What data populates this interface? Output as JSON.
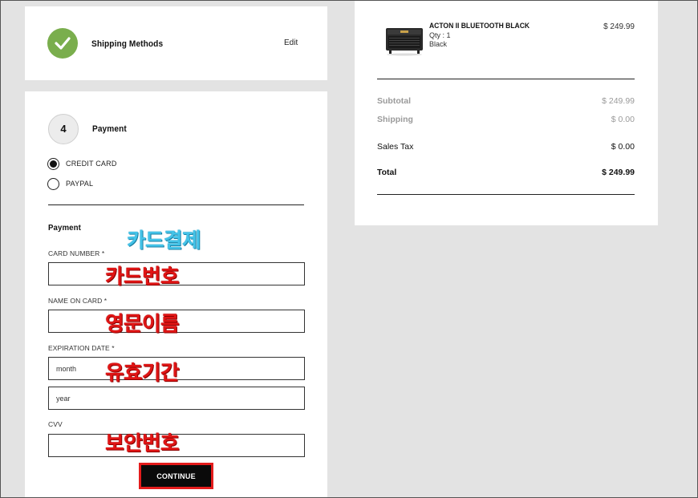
{
  "shipping": {
    "title": "Shipping Methods",
    "edit_label": "Edit"
  },
  "payment_step": {
    "number": "4",
    "title": "Payment",
    "methods": [
      {
        "label": "CREDIT CARD",
        "selected": true
      },
      {
        "label": "PAYPAL",
        "selected": false
      }
    ]
  },
  "payment_form": {
    "section_title": "Payment",
    "card_number_label": "CARD NUMBER *",
    "name_on_card_label": "NAME ON CARD *",
    "expiration_label": "EXPIRATION DATE *",
    "month_placeholder": "month",
    "year_placeholder": "year",
    "cvv_label": "CVV",
    "continue_label": "CONTINUE"
  },
  "annotations": {
    "card_payment": "카드결제",
    "card_number": "카드번호",
    "english_name": "영문이름",
    "validity_period": "유효기간",
    "security_code": "보안번호",
    "colors": {
      "cyan": "#44c3e8",
      "red": "#e01515",
      "highlight_border": "#e41c1c"
    }
  },
  "order_summary": {
    "product": {
      "name": "ACTON II BLUETOOTH BLACK",
      "qty": "Qty : 1",
      "color": "Black",
      "price": "$ 249.99",
      "icon": "speaker-thumbnail"
    },
    "subtotal_label": "Subtotal",
    "subtotal_value": "$ 249.99",
    "shipping_label": "Shipping",
    "shipping_value": "$ 0.00",
    "tax_label": "Sales Tax",
    "tax_value": "$ 0.00",
    "total_label": "Total",
    "total_value": "$ 249.99"
  },
  "colors": {
    "background": "#e3e3e3",
    "check_green": "#7aae4d",
    "button_black": "#0a0a0a"
  }
}
